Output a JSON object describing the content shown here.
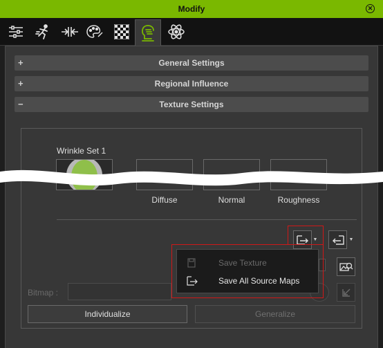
{
  "window": {
    "title": "Modify"
  },
  "tabs": [
    {
      "icon": "sliders-icon"
    },
    {
      "icon": "motion-icon"
    },
    {
      "icon": "pose-arrows-icon"
    },
    {
      "icon": "palette-icon"
    },
    {
      "icon": "checker-texture-icon"
    },
    {
      "icon": "head-wrinkle-icon",
      "active": true
    },
    {
      "icon": "physics-atom-icon"
    }
  ],
  "sections": {
    "general": {
      "sign": "+",
      "label": "General Settings"
    },
    "regional": {
      "sign": "+",
      "label": "Regional Influence"
    },
    "texture": {
      "sign": "−",
      "label": "Texture Settings"
    }
  },
  "texture_panel": {
    "wrinkle_set": "Wrinkle Set 1",
    "slots": [
      "Diffuse",
      "Normal",
      "Roughness"
    ],
    "bitmap_label": "Bitmap :",
    "bitmap_value": ""
  },
  "menu": {
    "items": [
      {
        "label": "Save Texture",
        "enabled": false,
        "icon": "save-texture-icon"
      },
      {
        "label": "Save All Source Maps",
        "enabled": true,
        "icon": "export-all-icon"
      }
    ]
  },
  "buttons": {
    "individualize": "Individualize",
    "generalize": "Generalize"
  },
  "colors": {
    "accent": "#7ab800",
    "highlight": "#d01818",
    "background": "#373737"
  }
}
